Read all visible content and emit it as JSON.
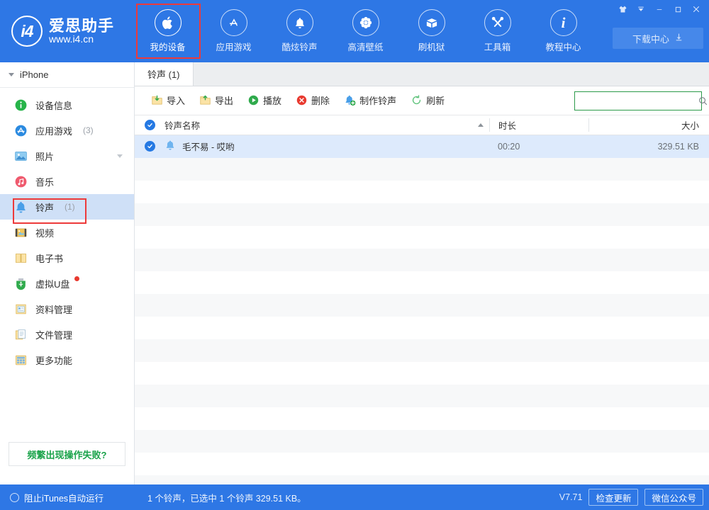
{
  "app": {
    "logo_mark": "i4",
    "logo_name": "爱思助手",
    "logo_url": "www.i4.cn"
  },
  "topnav": {
    "items": [
      {
        "label": "我的设备",
        "icon": "apple-icon",
        "active": true
      },
      {
        "label": "应用游戏",
        "icon": "appstore-icon",
        "active": false
      },
      {
        "label": "酷炫铃声",
        "icon": "bell-icon",
        "active": false
      },
      {
        "label": "高清壁纸",
        "icon": "flower-icon",
        "active": false
      },
      {
        "label": "刷机狱",
        "icon": "box-icon",
        "active": false
      },
      {
        "label": "工具箱",
        "icon": "tools-icon",
        "active": false
      },
      {
        "label": "教程中心",
        "icon": "info-icon",
        "active": false
      }
    ],
    "download_label": "下载中心",
    "download_icon": "download-icon"
  },
  "window_controls": [
    {
      "name": "skin-button",
      "glyph": "👕"
    },
    {
      "name": "menu-button",
      "glyph": "▼"
    },
    {
      "name": "minimize-button",
      "glyph": "—"
    },
    {
      "name": "maximize-button",
      "glyph": "◻"
    },
    {
      "name": "close-button",
      "glyph": "✕"
    }
  ],
  "sidebar": {
    "device_name": "iPhone",
    "items": [
      {
        "label": "设备信息",
        "count": "",
        "icon": "info-circle-icon",
        "selected": false,
        "chevron": false,
        "badge": false
      },
      {
        "label": "应用游戏",
        "count": "(3)",
        "icon": "appstore-circle-icon",
        "selected": false,
        "chevron": false,
        "badge": false
      },
      {
        "label": "照片",
        "count": "",
        "icon": "photo-icon",
        "selected": false,
        "chevron": true,
        "badge": false
      },
      {
        "label": "音乐",
        "count": "",
        "icon": "music-icon",
        "selected": false,
        "chevron": false,
        "badge": false
      },
      {
        "label": "铃声",
        "count": "(1)",
        "icon": "bell-icon",
        "selected": true,
        "chevron": false,
        "badge": false
      },
      {
        "label": "视频",
        "count": "",
        "icon": "video-icon",
        "selected": false,
        "chevron": false,
        "badge": false
      },
      {
        "label": "电子书",
        "count": "",
        "icon": "book-icon",
        "selected": false,
        "chevron": false,
        "badge": false
      },
      {
        "label": "虚拟U盘",
        "count": "",
        "icon": "usb-icon",
        "selected": false,
        "chevron": false,
        "badge": true
      },
      {
        "label": "资料管理",
        "count": "",
        "icon": "data-icon",
        "selected": false,
        "chevron": false,
        "badge": false
      },
      {
        "label": "文件管理",
        "count": "",
        "icon": "file-icon",
        "selected": false,
        "chevron": false,
        "badge": false
      },
      {
        "label": "更多功能",
        "count": "",
        "icon": "grid-icon",
        "selected": false,
        "chevron": false,
        "badge": false
      }
    ],
    "help_button": "频繁出现操作失败?"
  },
  "main": {
    "tab": "铃声 (1)",
    "toolbar": [
      {
        "label": "导入",
        "icon": "import-icon"
      },
      {
        "label": "导出",
        "icon": "export-icon"
      },
      {
        "label": "播放",
        "icon": "play-icon"
      },
      {
        "label": "删除",
        "icon": "delete-icon"
      },
      {
        "label": "制作铃声",
        "icon": "make-ringtone-icon"
      },
      {
        "label": "刷新",
        "icon": "refresh-icon"
      }
    ],
    "search": {
      "value": "",
      "placeholder": ""
    },
    "table": {
      "headers": {
        "name": "铃声名称",
        "duration": "时长",
        "size": "大小"
      },
      "sort": {
        "column": "name",
        "direction": "asc"
      },
      "rows": [
        {
          "name": "毛不易 - 哎哟",
          "duration": "00:20",
          "size": "329.51 KB",
          "checked": true,
          "icon": "bell-icon"
        }
      ],
      "empty_row_count": 15
    }
  },
  "statusbar": {
    "block_itunes": "阻止iTunes自动运行",
    "summary": "1 个铃声，已选中 1 个铃声 329.51 KB。",
    "version": "V7.71",
    "check_update": "检查更新",
    "wechat": "微信公众号"
  },
  "colors": {
    "brand_blue": "#2e77e5",
    "selection_blue": "#cfe0f7",
    "row_selected": "#ddeafc",
    "highlight_red": "#ed3a3a",
    "green": "#1aa34a",
    "search_border": "#2c9a4a"
  }
}
